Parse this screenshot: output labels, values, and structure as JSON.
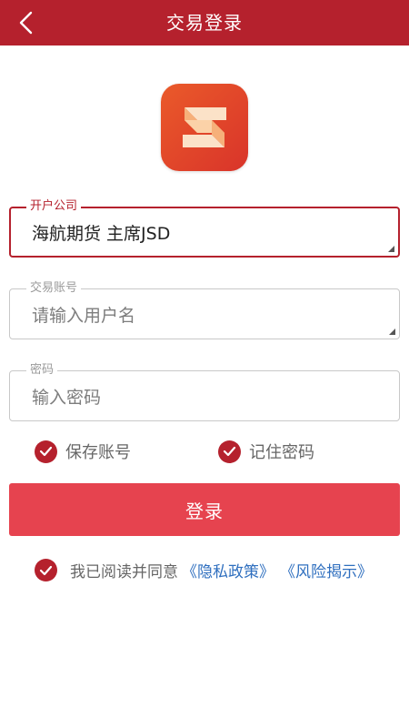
{
  "header": {
    "title": "交易登录",
    "back_icon": "chevron-left-icon",
    "background": "#b5212d"
  },
  "logo": {
    "icon": "app-logo-s",
    "color": "#e2452a"
  },
  "form": {
    "company": {
      "label": "开户公司",
      "value": "海航期货 主席JSD"
    },
    "account": {
      "label": "交易账号",
      "placeholder": "请输入用户名"
    },
    "password": {
      "label": "密码",
      "placeholder": "输入密码"
    }
  },
  "options": {
    "save_account": {
      "label": "保存账号",
      "checked": true
    },
    "remember_password": {
      "label": "记住密码",
      "checked": true
    }
  },
  "login_button": {
    "label": "登录",
    "color": "#e6434f"
  },
  "agreement": {
    "checked": true,
    "text": "我已阅读并同意",
    "privacy_link": "《隐私政策》",
    "risk_link": "《风险揭示》",
    "link_color": "#2f6fbf"
  }
}
